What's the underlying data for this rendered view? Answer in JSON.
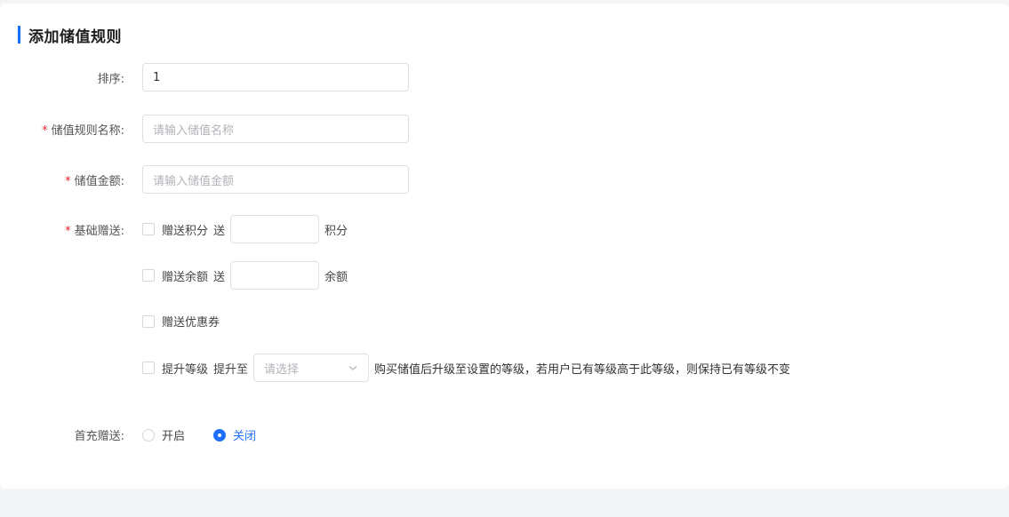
{
  "form": {
    "title": "添加储值规则",
    "sort": {
      "label": "排序:",
      "value": "1"
    },
    "rule_name": {
      "required": "*",
      "label": "储值规则名称:",
      "placeholder": "请输入储值名称"
    },
    "amount": {
      "required": "*",
      "label": "储值金额:",
      "placeholder": "请输入储值金额"
    },
    "basic_gift": {
      "required": "*",
      "label": "基础赠送:",
      "points": {
        "label": "赠送积分",
        "send": "送",
        "unit": "积分"
      },
      "balance": {
        "label": "赠送余额",
        "send": "送",
        "unit": "余额"
      },
      "coupon": {
        "label": "赠送优惠券"
      },
      "level": {
        "label": "提升等级",
        "upgrade_to": "提升至",
        "select_placeholder": "请选择",
        "hint": "购买储值后升级至设置的等级，若用户已有等级高于此等级，则保持已有等级不变"
      }
    },
    "first_charge": {
      "label": "首充赠送:",
      "options": [
        {
          "label": "开启",
          "checked": false
        },
        {
          "label": "关闭",
          "checked": true
        }
      ]
    }
  },
  "colors": {
    "accent": "#1e6fff",
    "required": "#f5222d"
  }
}
